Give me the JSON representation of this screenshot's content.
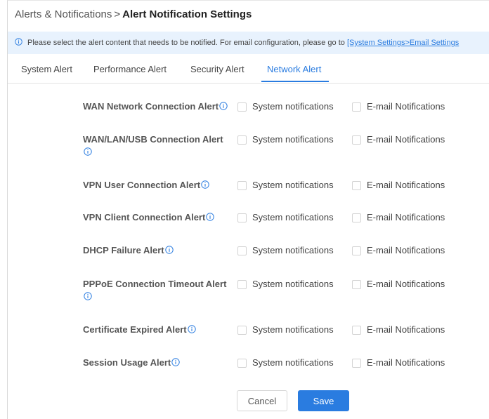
{
  "breadcrumb": {
    "parent": "Alerts & Notifications",
    "separator": ">",
    "current": "Alert Notification Settings"
  },
  "banner": {
    "icon": "info-icon",
    "text": "Please select the alert content that needs to be notified. For email configuration, please go to ",
    "link": "[System Settings>Email Settings"
  },
  "tabs": [
    {
      "label": "System Alert",
      "active": false
    },
    {
      "label": "Performance Alert",
      "active": false
    },
    {
      "label": "Security Alert",
      "active": false
    },
    {
      "label": "Network Alert",
      "active": true
    }
  ],
  "options": {
    "system": "System notifications",
    "email": "E-mail Notifications"
  },
  "alerts": [
    {
      "label": "WAN Network Connection Alert",
      "system_checked": false,
      "email_checked": false
    },
    {
      "label": "WAN/LAN/USB Connection Alert",
      "system_checked": false,
      "email_checked": false
    },
    {
      "label": "VPN User Connection Alert",
      "system_checked": false,
      "email_checked": false
    },
    {
      "label": "VPN Client Connection Alert",
      "system_checked": false,
      "email_checked": false
    },
    {
      "label": "DHCP Failure Alert",
      "system_checked": false,
      "email_checked": false
    },
    {
      "label": "PPPoE Connection Timeout Alert",
      "system_checked": false,
      "email_checked": false
    },
    {
      "label": "Certificate Expired Alert",
      "system_checked": false,
      "email_checked": false
    },
    {
      "label": "Session Usage Alert",
      "system_checked": false,
      "email_checked": false
    }
  ],
  "buttons": {
    "cancel": "Cancel",
    "save": "Save"
  },
  "colors": {
    "accent": "#2a7ce0",
    "banner_bg": "#e8f2fd"
  }
}
